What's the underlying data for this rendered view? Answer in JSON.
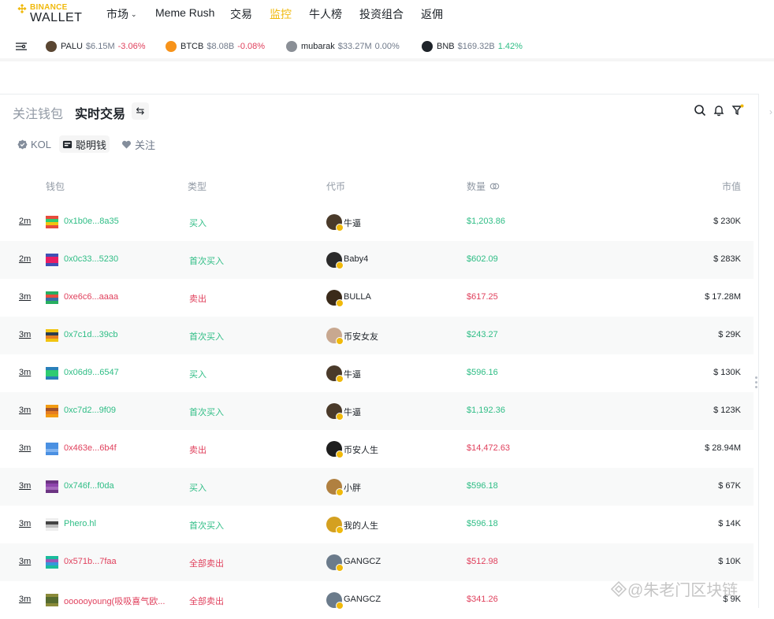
{
  "brand": {
    "top": "BINANCE",
    "bottom": "WALLET",
    "accent": "#f0b90b"
  },
  "nav": [
    "市场",
    "Meme Rush",
    "交易",
    "监控",
    "牛人榜",
    "投资组合",
    "返佣"
  ],
  "nav_active_index": 3,
  "ticker": [
    {
      "symbol": "PALU",
      "mcap": "$6.15M",
      "change": "-3.06%",
      "dir": "down"
    },
    {
      "symbol": "BTCB",
      "mcap": "$8.08B",
      "change": "-0.08%",
      "dir": "down"
    },
    {
      "symbol": "mubarak",
      "mcap": "$33.27M",
      "change": "0.00%",
      "dir": "flat"
    },
    {
      "symbol": "BNB",
      "mcap": "$169.32B",
      "change": "1.42%",
      "dir": "up"
    }
  ],
  "tabs": {
    "watch": "关注钱包",
    "live": "实时交易",
    "swap_icon": "⇆"
  },
  "filters": {
    "kol": "KOL",
    "smart": "聪明钱",
    "follow": "关注"
  },
  "columns": {
    "wallet": "钱包",
    "type": "类型",
    "token": "代币",
    "amount": "数量",
    "mcap": "市值"
  },
  "colors": {
    "buy": "#2ebd85",
    "sell": "#e0415d"
  },
  "rows": [
    {
      "time": "2m",
      "wallet": "0x1b0e...8a35",
      "side": "buy",
      "type": "买入",
      "token": "牛逼",
      "amount": "$1,203.86",
      "mcap": "$ 230K"
    },
    {
      "time": "2m",
      "wallet": "0x0c33...5230",
      "side": "buy",
      "type": "首次买入",
      "token": "Baby4",
      "amount": "$602.09",
      "mcap": "$ 283K"
    },
    {
      "time": "3m",
      "wallet": "0xe6c6...aaaa",
      "side": "sell",
      "type": "卖出",
      "token": "BULLA",
      "amount": "$617.25",
      "mcap": "$ 17.28M"
    },
    {
      "time": "3m",
      "wallet": "0x7c1d...39cb",
      "side": "buy",
      "type": "首次买入",
      "token": "币安女友",
      "amount": "$243.27",
      "mcap": "$ 29K"
    },
    {
      "time": "3m",
      "wallet": "0x06d9...6547",
      "side": "buy",
      "type": "买入",
      "token": "牛逼",
      "amount": "$596.16",
      "mcap": "$ 130K"
    },
    {
      "time": "3m",
      "wallet": "0xc7d2...9f09",
      "side": "buy",
      "type": "首次买入",
      "token": "牛逼",
      "amount": "$1,192.36",
      "mcap": "$ 123K"
    },
    {
      "time": "3m",
      "wallet": "0x463e...6b4f",
      "side": "sell",
      "type": "卖出",
      "token": "币安人生",
      "amount": "$14,472.63",
      "mcap": "$ 28.94M"
    },
    {
      "time": "3m",
      "wallet": "0x746f...f0da",
      "side": "buy",
      "type": "买入",
      "token": "小胖",
      "amount": "$596.18",
      "mcap": "$ 67K"
    },
    {
      "time": "3m",
      "wallet": "Phero.hl",
      "side": "buy",
      "type": "首次买入",
      "token": "我的人生",
      "amount": "$596.18",
      "mcap": "$ 14K"
    },
    {
      "time": "3m",
      "wallet": "0x571b...7faa",
      "side": "sell",
      "type": "全部卖出",
      "token": "GANGCZ",
      "amount": "$512.98",
      "mcap": "$ 10K"
    },
    {
      "time": "3m",
      "wallet": "oooooyoung(吸吸喜气欧...",
      "side": "sell",
      "type": "全部卖出",
      "token": "GANGCZ",
      "amount": "$341.26",
      "mcap": "$ 9K"
    }
  ],
  "watermark": "@朱老门区块链"
}
